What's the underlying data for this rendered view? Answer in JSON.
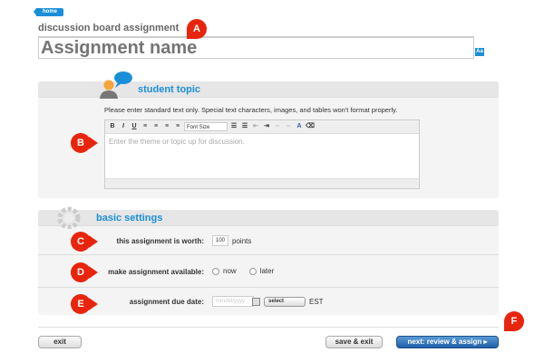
{
  "nav": {
    "home": "home"
  },
  "page": {
    "title": "discussion board assignment",
    "name_placeholder": "Assignment name",
    "format_icon": "Aa"
  },
  "student_topic": {
    "title": "student topic",
    "instructions": "Please enter standard text only. Special text characters, images, and tables won't format properly.",
    "toolbar": {
      "bold": "B",
      "italic": "I",
      "underline": "U",
      "font_size": "Font Size",
      "color": "A"
    },
    "placeholder": "Enter the theme or topic up for discussion."
  },
  "basic_settings": {
    "title": "basic settings",
    "worth_label": "this assignment is worth:",
    "worth_value": "100",
    "worth_unit": "points",
    "available_label": "make assignment available:",
    "opt_now": "now",
    "opt_later": "later",
    "due_label": "assignment due date:",
    "due_placeholder": "mm/dd/yyyy",
    "time_select": "select",
    "timezone": "EST"
  },
  "buttons": {
    "exit": "exit",
    "save_exit": "save & exit",
    "next": "next: review & assign ▸"
  },
  "callouts": [
    "A",
    "B",
    "C",
    "D",
    "E",
    "F"
  ],
  "colors": {
    "accent": "#1a8fd8",
    "callout": "#e8250c"
  }
}
